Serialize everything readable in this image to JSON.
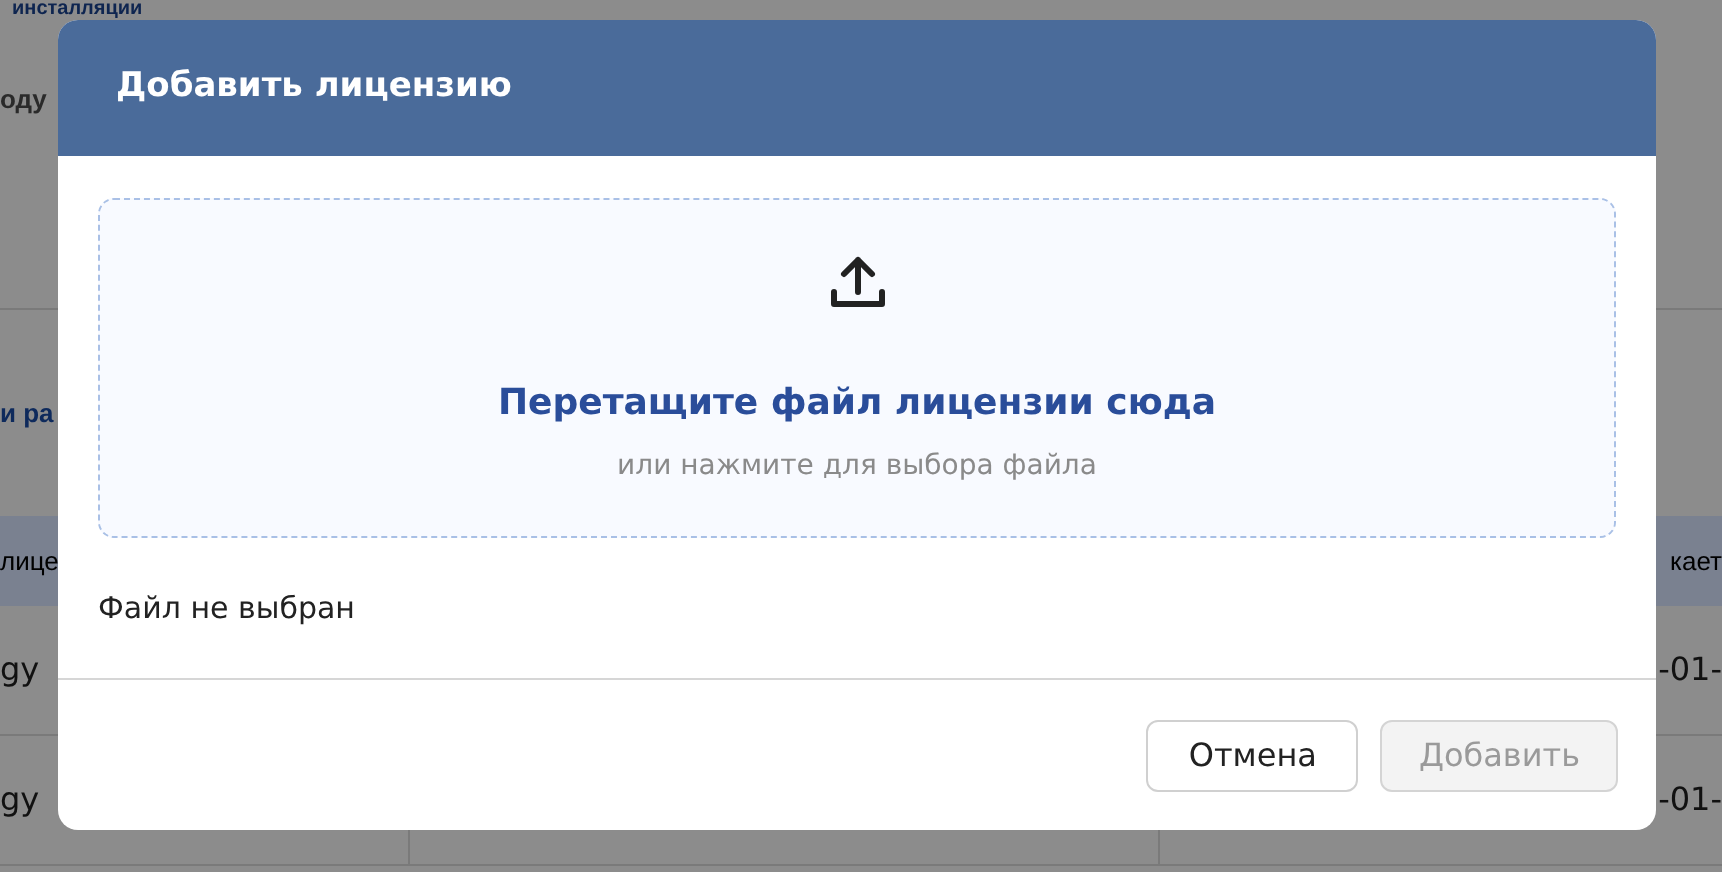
{
  "page": {
    "title": "инсталляции",
    "subtitle": "оду",
    "section_heading": "и ра",
    "table": {
      "header_left": "лице",
      "header_right": "кает",
      "rows": [
        {
          "left": "gy",
          "right": "-01-"
        },
        {
          "left": "gy",
          "right": "-01-"
        }
      ]
    }
  },
  "dialog": {
    "title": "Добавить лицензию",
    "dropzone": {
      "title": "Перетащите файл лицензии сюда",
      "hint": "или нажмите для выбора файла"
    },
    "file_status": "Файл не выбран",
    "buttons": [
      {
        "label": "Отмена",
        "kind": "secondary",
        "disabled": false
      },
      {
        "label": "Добавить",
        "kind": "primary",
        "disabled": true
      }
    ]
  }
}
